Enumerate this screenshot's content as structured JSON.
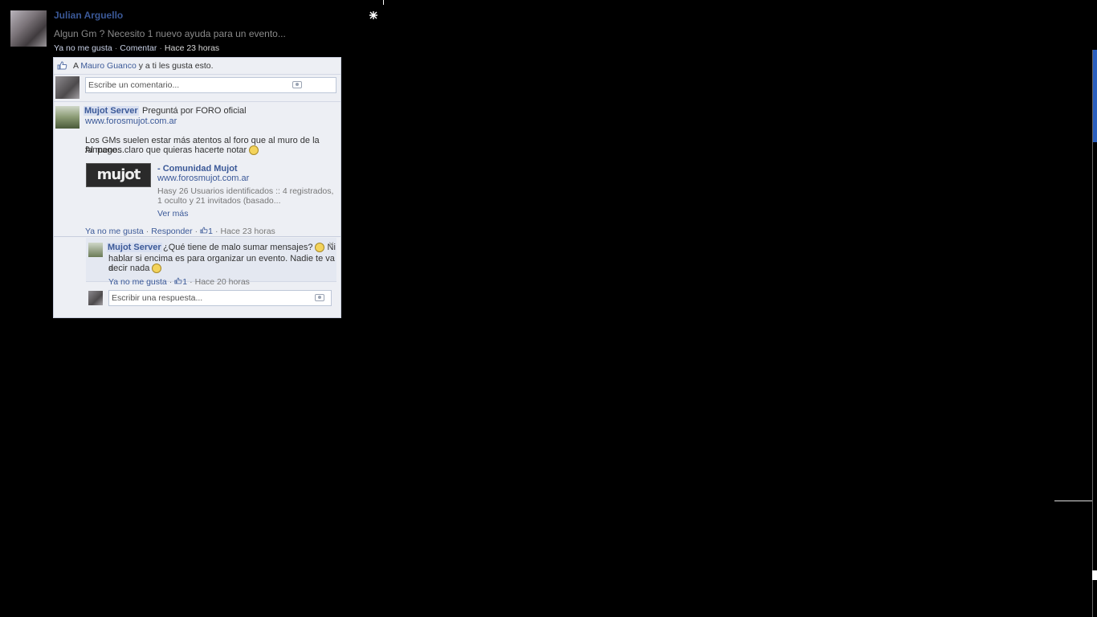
{
  "post": {
    "author": "Julian Arguello",
    "text": "Algun Gm ? Necesito 1 nuevo ayuda para un evento...",
    "meta": {
      "unlike": "Ya no me gusta",
      "comment": "Comentar",
      "time": "Hace 23 horas"
    }
  },
  "likes": {
    "prefix": "A ",
    "name": "Mauro Guanco",
    "suffix": " y a ti les gusta esto."
  },
  "comment_input": {
    "placeholder": "Escribe un comentario..."
  },
  "comment": {
    "author": "Mujot Server",
    "text": "Preguntá por FORO oficial",
    "link": "www.forosmujot.com.ar",
    "body1": "Los GMs suelen estar más atentos al foro que al muro de la fanpage...",
    "body2": "Al menos claro que quieras hacerte notar",
    "attachment": {
      "thumb_text": "mujot",
      "title": "- Comunidad Mujot",
      "url": "www.forosmujot.com.ar",
      "desc": "Hasy 26 Usuarios identificados :: 4 registrados, 1 oculto y 21 invitados (basado...",
      "more": "Ver más"
    },
    "meta": {
      "unlike": "Ya no me gusta",
      "reply": "Responder",
      "likes": "1",
      "time": "Hace 23 horas"
    }
  },
  "reply": {
    "author": "Mujot Server",
    "text1": "¿Qué tiene de malo sumar mensajes?",
    "text1b": "Ni",
    "text2": "hablar si encima es para organizar un evento. Nadie te va a",
    "text3": "decir nada",
    "close": "×",
    "meta": {
      "unlike": "Ya no me gusta",
      "likes": "1",
      "time": "Hace 20 horas"
    }
  },
  "reply_input": {
    "placeholder": "Escribir una respuesta..."
  },
  "colors": {
    "link": "#3b5998",
    "panel": "#edeff4",
    "background": "#000000",
    "scrollbar": "#2a5fbf"
  }
}
